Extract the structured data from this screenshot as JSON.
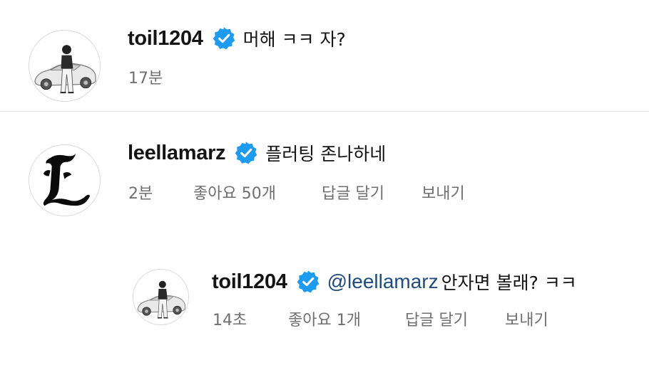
{
  "colors": {
    "verified_badge": "#1d9bf0",
    "mention": "#1e4b80",
    "meta_text": "#6f6f6f",
    "divider": "#e3e3e3"
  },
  "comments": [
    {
      "avatar": "car-person-avatar",
      "username": "toil1204",
      "verified": true,
      "text": "머해 ㅋㅋ 자?",
      "time": "17분"
    },
    {
      "avatar": "gothic-letter-l-avatar",
      "username": "leellamarz",
      "verified": true,
      "text": "플러팅 존나하네",
      "time": "2분",
      "likes": "좋아요 50개",
      "reply_label": "답글 달기",
      "send_label": "보내기"
    },
    {
      "avatar": "car-person-avatar",
      "username": "toil1204",
      "verified": true,
      "mention": "@leellamarz",
      "text": "안자면 볼래? ㅋㅋ",
      "time": "14초",
      "likes": "좋아요 1개",
      "reply_label": "답글 달기",
      "send_label": "보내기"
    }
  ]
}
